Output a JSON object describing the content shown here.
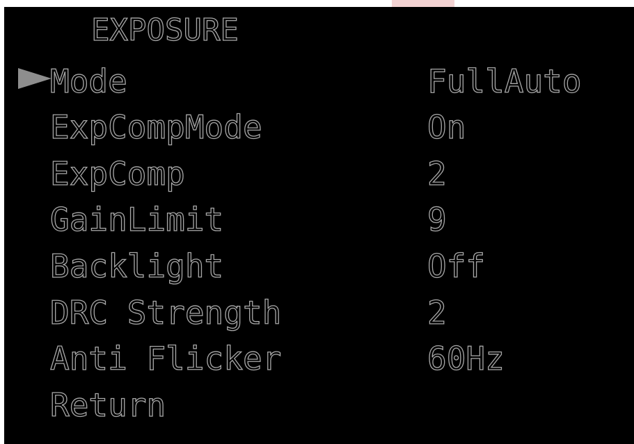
{
  "menu": {
    "title": "EXPOSURE",
    "selected_marker": "right-triangle-icon",
    "items": [
      {
        "label": "Mode",
        "value": "FullAuto"
      },
      {
        "label": "ExpCompMode",
        "value": "On"
      },
      {
        "label": "ExpComp",
        "value": "2"
      },
      {
        "label": "GainLimit",
        "value": "9"
      },
      {
        "label": "Backlight",
        "value": "Off"
      },
      {
        "label": "DRC Strength",
        "value": "2"
      },
      {
        "label": "Anti Flicker",
        "value": "60Hz"
      },
      {
        "label": "Return",
        "value": ""
      }
    ]
  },
  "colors": {
    "background": "#000000",
    "text_outline": "#a8a8a8",
    "cursor": "#8e8e8e"
  }
}
